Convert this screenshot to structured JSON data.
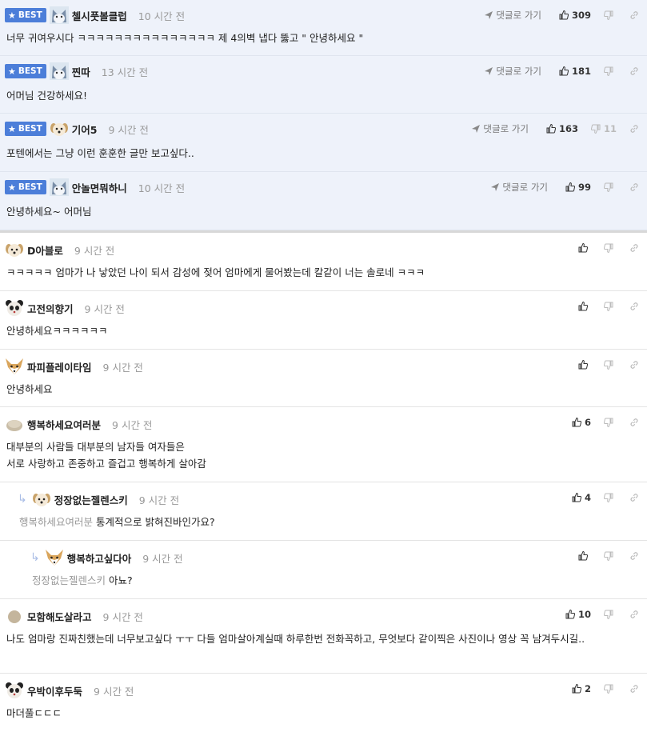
{
  "labels": {
    "best": "BEST",
    "go_reply": "댓글로 가기"
  },
  "colors": {
    "best_bg": "#eef2fa",
    "badge": "#4c7ed9"
  },
  "comments": [
    {
      "best": true,
      "nick": "첼시풋볼클럽",
      "time": "10 시간 전",
      "text": "너무 귀여우시다 ㅋㅋㅋㅋㅋㅋㅋㅋㅋㅋㅋㅋㅋㅋㅋ 제 4의벽 냅다 뚫고 \" 안녕하세요 \"",
      "likes": "309",
      "dislikes": "",
      "avatar": "husky"
    },
    {
      "best": true,
      "nick": "찐따",
      "time": "13 시간 전",
      "text": "어머님 건강하세요!",
      "likes": "181",
      "dislikes": "",
      "avatar": "husky"
    },
    {
      "best": true,
      "nick": "기어5",
      "time": "9 시간 전",
      "text": "포텐에서는 그냥 이런 훈훈한 글만 보고싶다..",
      "likes": "163",
      "dislikes": "11",
      "avatar": "puppy"
    },
    {
      "best": true,
      "nick": "안놀면뭐하니",
      "time": "10 시간 전",
      "text": "안녕하세요~ 어머님",
      "likes": "99",
      "dislikes": "",
      "avatar": "husky"
    },
    {
      "best": false,
      "nick": "D아블로",
      "time": "9 시간 전",
      "text": "ㅋㅋㅋㅋㅋ 엄마가 나 낳았던 나이 되서 감성에 젖어 엄마에게 물어봤는데 칼같이 너는 솔로네 ㅋㅋㅋ",
      "likes": "",
      "dislikes": "",
      "avatar": "puppy"
    },
    {
      "best": false,
      "nick": "고전의향기",
      "time": "9 시간 전",
      "text": "안녕하세요ㅋㅋㅋㅋㅋㅋ",
      "likes": "",
      "dislikes": "",
      "avatar": "panda"
    },
    {
      "best": false,
      "nick": "파피플레이타임",
      "time": "9 시간 전",
      "text": "안녕하세요",
      "likes": "",
      "dislikes": "",
      "avatar": "fox"
    },
    {
      "best": false,
      "nick": "행복하세요여러분",
      "time": "9 시간 전",
      "text": "대부분의 사람들 대부분의 남자들 여자들은",
      "text2": "서로 사랑하고 존중하고 즐겁고 행복하게 살아감",
      "likes": "6",
      "dislikes": "",
      "avatar": "blob"
    },
    {
      "best": false,
      "reply": 1,
      "nick": "정장없는젤렌스키",
      "time": "9 시간 전",
      "parent": "행복하세요여러분",
      "text": "통계적으로 밝혀진바인가요?",
      "likes": "4",
      "dislikes": "",
      "avatar": "puppy"
    },
    {
      "best": false,
      "reply": 2,
      "nick": "행복하고싶다아",
      "time": "9 시간 전",
      "parent": "정장없는젤렌스키",
      "text": "아뇨?",
      "likes": "",
      "dislikes": "",
      "avatar": "fox"
    },
    {
      "best": false,
      "nick": "모함해도살라고",
      "time": "9 시간 전",
      "text": "나도 엄마랑 진짜친했는데 너무보고싶다 ㅜㅜ 다들 엄마살아계실때 하루한번 전화꼭하고, 무엇보다 같이찍은 사진이나 영상 꼭 남겨두시길..",
      "likes": "10",
      "dislikes": "",
      "avatar": "dot"
    },
    {
      "best": false,
      "nick": "우박이후두둑",
      "time": "9 시간 전",
      "text": "마더풀ㄷㄷㄷ",
      "likes": "2",
      "dislikes": "",
      "avatar": "panda"
    }
  ]
}
